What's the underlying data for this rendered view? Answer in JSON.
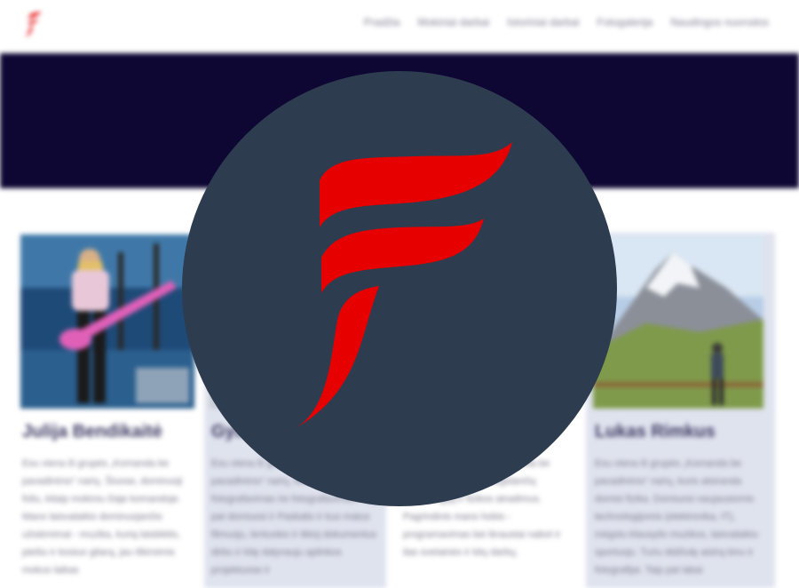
{
  "nav": {
    "items": [
      "Pradžia",
      "Mokiniai darbai",
      "Istoriniai darbai",
      "Fotogalerija",
      "Naudingos nuorodos"
    ]
  },
  "team": [
    {
      "name": "Julija Bendikaitė",
      "desc": "Esu viena iš grupės „Komanda be pavadinimo“ narių. Šiuose, dominuoji foliu, kitaip mokiniu čiaje komandoje. Mano laisvalaikio dominuojančio užsiėmimai - muzika, kurią laisblėtis, piešiu ir kosiuo gitarą, jau iškirsimis mokus laikas"
    },
    {
      "name": "Gylis",
      "desc": "Esu viena iš grupės „Komanda be pavadinimo“ narių, kuris laikas uis fotografavimas ire fotografavimas. Taip pat domiuosi ir Paskalio ir kus matus filmuoju, lentuoles ir tiktoj dokumentus dirbu ir kitę dalyvauju aplinkos projektuose ir"
    },
    {
      "name": "",
      "desc": "Esu viena iš grupės „Komanda be pavadinimo“ narių, mėgstančių technologiją ir fizikos atradimus. Pagrindinis mano hobis - programavimas bei ikraustai nabot ir ilas svetainės ir kitų darbų."
    },
    {
      "name": "Lukas Rimkus",
      "desc": "Esu viena iš grupės „Komanda be pavadinimo“ narių, kuris atsiranda domisi fizika. Domiuosi naujausiomis technologijomis (elektronika, IT), mėgstu klausytis muzikos, laisvalaikiu sportuoju. Turiu didžiulę aistrą kinu ir fotografijai. Taip pat labai"
    }
  ],
  "colors": {
    "hero": "#0e0633",
    "overlay_circle": "#2d3c4f",
    "logo_red": "#e60000",
    "card_shade": "#dfe3ee",
    "name_text": "#3d3a63"
  },
  "icons": {
    "site_logo": "brand-f-icon",
    "overlay_logo": "brand-f-icon"
  }
}
